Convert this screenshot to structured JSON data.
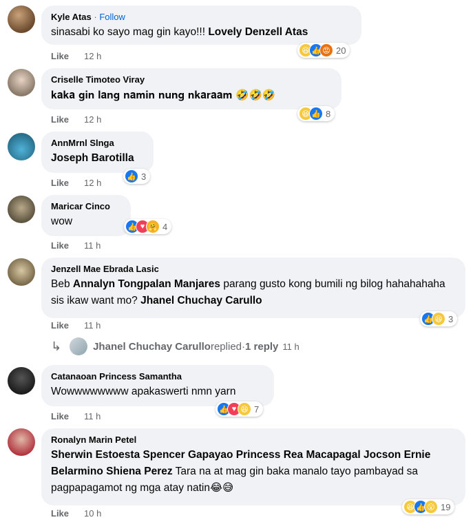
{
  "comments": [
    {
      "author": "Kyle Atas",
      "follow": "Follow",
      "text_parts": [
        {
          "text": "sinasabi ko sayo mag gin kayo!!! ",
          "mention": false
        },
        {
          "text": "Lovely Denzell Atas",
          "mention": true
        }
      ],
      "like": "Like",
      "time": "12 h",
      "reaction_icons": [
        "haha-icon",
        "like-icon",
        "angry-icon"
      ],
      "reaction_count": "20"
    },
    {
      "author": "Criselle Timoteo Viray",
      "text_parts": [
        {
          "text": "𝐤𝐚𝐤𝐚 𝐠𝐢𝐧 𝐥𝐚𝐧𝐠 𝐧𝐚𝐦𝐢𝐧 𝐧𝐮𝐧𝐠 𝐧𝐤𝐚𝐫𝐚𝐚𝐦 🤣🤣🤣",
          "mention": false
        }
      ],
      "like": "Like",
      "time": "12 h",
      "reaction_icons": [
        "haha-icon",
        "like-icon"
      ],
      "reaction_count": "8"
    },
    {
      "author": "AnnMrnl Slnga",
      "text_parts": [
        {
          "text": "Joseph Barotilla",
          "mention": true
        }
      ],
      "like": "Like",
      "time": "12 h",
      "reaction_icons": [
        "like-icon"
      ],
      "reaction_count": "3"
    },
    {
      "author": "Maricar Cinco",
      "text_parts": [
        {
          "text": "wow",
          "mention": false
        }
      ],
      "like": "Like",
      "time": "11 h",
      "reaction_icons": [
        "like-icon",
        "love-icon",
        "care-icon"
      ],
      "reaction_count": "4"
    },
    {
      "author": "Jenzell Mae Ebrada Lasic",
      "text_parts": [
        {
          "text": "Beb ",
          "mention": false
        },
        {
          "text": "Annalyn Tongpalan Manjares",
          "mention": true
        },
        {
          "text": " parang gusto kong bumili ng bilog hahahahaha sis ikaw want mo? ",
          "mention": false
        },
        {
          "text": "Jhanel Chuchay Carullo",
          "mention": true
        }
      ],
      "like": "Like",
      "time": "11 h",
      "reaction_icons": [
        "like-icon",
        "haha-icon"
      ],
      "reaction_count": "3"
    },
    {
      "author": "Catanaoan Princess Samantha",
      "text_parts": [
        {
          "text": "Wowwwwwwww apakaswerti nmn yarn",
          "mention": false
        }
      ],
      "like": "Like",
      "time": "11 h",
      "reaction_icons": [
        "like-icon",
        "love-icon",
        "haha-icon"
      ],
      "reaction_count": "7"
    },
    {
      "author": "Ronalyn Marin Petel",
      "text_parts": [
        {
          "text": "Sherwin Estoesta Spencer Gapayao Princess Rea Macapagal Jocson Ernie Belarmino Shiena Perez",
          "mention": true
        },
        {
          "text": " Tara na at mag gin baka manalo tayo pambayad sa pagpapagamot ng mga atay natin😂😅",
          "mention": false
        }
      ],
      "like": "Like",
      "time": "10 h",
      "reaction_icons": [
        "haha-icon",
        "like-icon",
        "wow-icon"
      ],
      "reaction_count": "19"
    }
  ],
  "reply": {
    "arrow_icon": "reply-arrow-icon",
    "name": "Jhanel Chuchay Carullo",
    "replied": " replied",
    "sep": " · ",
    "count": "1 reply",
    "time": "11 h"
  },
  "colors": {
    "bubble": "#f0f2f5",
    "meta": "#65676b",
    "follow": "#0064d1",
    "like": "#1877f2",
    "haha": "#f7c83a",
    "love": "#f33e58",
    "angry": "#e9710f"
  }
}
